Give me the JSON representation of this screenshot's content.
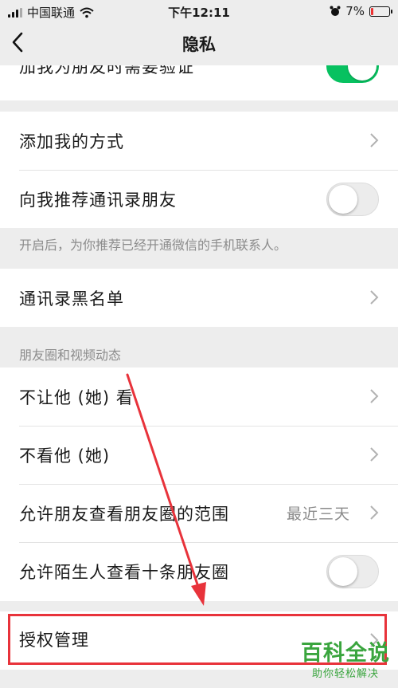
{
  "status_bar": {
    "carrier": "中国联通",
    "time": "下午12:11",
    "battery_percent": "7%"
  },
  "nav": {
    "title": "隐私",
    "back_icon": "chevron-left-icon"
  },
  "top_partial_row": {
    "label": "加我为朋友时需要验证",
    "toggle_on": true
  },
  "contact_section": {
    "add_me_label": "添加我的方式",
    "recommend_label": "向我推荐通讯录朋友",
    "recommend_toggle_on": false,
    "hint": "开启后，为你推荐已经开通微信的手机联系人。"
  },
  "blacklist": {
    "label": "通讯录黑名单"
  },
  "moments_section": {
    "title": "朋友圈和视频动态",
    "rows": {
      "block_view_label": "不让他 (她) 看",
      "hide_label": "不看他 (她)",
      "range_label": "允许朋友查看朋友圈的范围",
      "range_value": "最近三天",
      "stranger_label": "允许陌生人查看十条朋友圈",
      "stranger_toggle_on": false
    }
  },
  "authorization": {
    "label": "授权管理"
  },
  "watermark": {
    "main": "百科全说",
    "sub": "助你轻松解决"
  },
  "colors": {
    "background": "#ededed",
    "toggle_on": "#07c160",
    "highlight": "#e8333b",
    "watermark": "#3aa53e"
  }
}
